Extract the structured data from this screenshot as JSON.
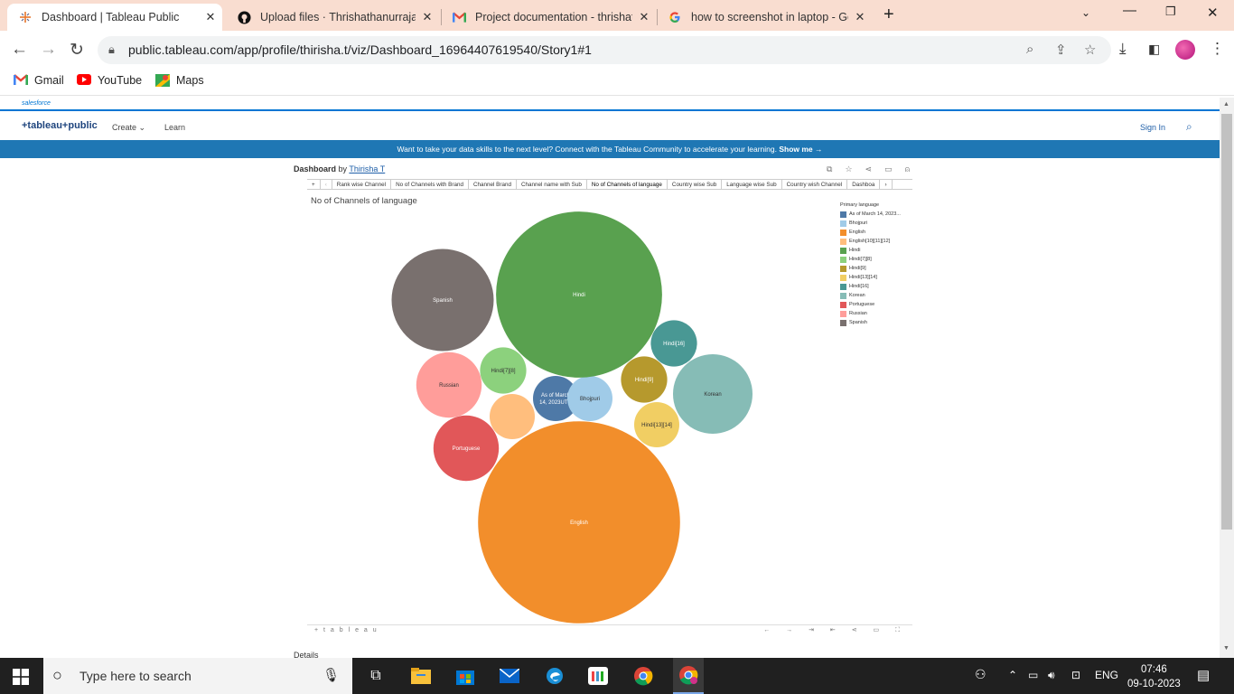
{
  "browser": {
    "tabs": [
      {
        "title": "Dashboard | Tableau Public",
        "icon": "tableau-icon",
        "active": true
      },
      {
        "title": "Upload files · Thrishathanurrajan",
        "icon": "github-icon",
        "active": false
      },
      {
        "title": "Project documentation - thrishat",
        "icon": "gmail-icon",
        "active": false
      },
      {
        "title": "how to screenshot in laptop - Go",
        "icon": "google-icon",
        "active": false
      }
    ],
    "url": "public.tableau.com/app/profile/thirisha.t/viz/Dashboard_16964407619540/Story1#1",
    "bookmarks": [
      {
        "label": "Gmail",
        "icon": "gmail-icon"
      },
      {
        "label": "YouTube",
        "icon": "youtube-icon"
      },
      {
        "label": "Maps",
        "icon": "maps-icon"
      }
    ]
  },
  "tableau": {
    "salesforce_label": "salesforce",
    "logo": "+tableau+public",
    "nav": {
      "create": "Create",
      "learn": "Learn",
      "sign_in": "Sign In"
    },
    "banner_text": "Want to take your data skills to the next level? Connect with the Tableau Community to accelerate your learning.",
    "banner_link": "Show me →",
    "dashboard_label": "Dashboard",
    "by_label": "by",
    "author": "Thirisha T",
    "story_tabs": [
      "Rank wise Channel",
      "No of Channels with Brand",
      "Channel Brand",
      "Channel name with Sub",
      "No of Channels of language",
      "Country wise Sub",
      "Language wise Sub",
      "Country wish Channel",
      "Dashboa"
    ],
    "active_story_tab": 4,
    "sheet_title": "No of Channels of language",
    "legend_title": "Primary language",
    "footer_brand": "+ t a b l e a u",
    "details_label": "Details"
  },
  "chart_data": {
    "type": "bubble",
    "title": "No of Channels of language",
    "legend_title": "Primary language",
    "series": [
      {
        "name": "As of March 14, 2023UTC",
        "label": "As of March 14, 2023UTC",
        "color": "#4e79a7",
        "value": 1
      },
      {
        "name": "Bhojpuri",
        "label": "Bhojpuri",
        "color": "#a0cbe8",
        "value": 1
      },
      {
        "name": "English",
        "label": "English",
        "color": "#f28e2b",
        "value": 20
      },
      {
        "name": "English[10][11][12]",
        "label": "",
        "color": "#ffbe7d",
        "value": 1
      },
      {
        "name": "Hindi",
        "label": "Hindi",
        "color": "#59a14f",
        "value": 13.5
      },
      {
        "name": "Hindi[7][8]",
        "label": "Hindi[7][8]",
        "color": "#8cd17d",
        "value": 1.05
      },
      {
        "name": "Hindi[9]",
        "label": "Hindi[9]",
        "color": "#b6992d",
        "value": 1.05
      },
      {
        "name": "Hindi[13][14]",
        "label": "Hindi[13][14]",
        "color": "#f1ce63",
        "value": 1
      },
      {
        "name": "Hindi[16]",
        "label": "Hindi[16]",
        "color": "#499894",
        "value": 1.05
      },
      {
        "name": "Korean",
        "label": "Korean",
        "color": "#86bcb6",
        "value": 3.1
      },
      {
        "name": "Portuguese",
        "label": "Portuguese",
        "color": "#e15759",
        "value": 2.1
      },
      {
        "name": "Russian",
        "label": "Russian",
        "color": "#ff9d9a",
        "value": 2.1
      },
      {
        "name": "Spanish",
        "label": "Spanish",
        "color": "#79706e",
        "value": 5.1
      }
    ],
    "legend_entries": [
      "As of March 14, 2023...",
      "Bhojpuri",
      "English",
      "English[10][11][12]",
      "Hindi",
      "Hindi[7][8]",
      "Hindi[9]",
      "Hindi[13][14]",
      "Hindi[16]",
      "Korean",
      "Portuguese",
      "Russian",
      "Spanish"
    ]
  },
  "taskbar": {
    "search_placeholder": "Type here to search",
    "language": "ENG",
    "time": "07:46",
    "date": "09-10-2023"
  }
}
